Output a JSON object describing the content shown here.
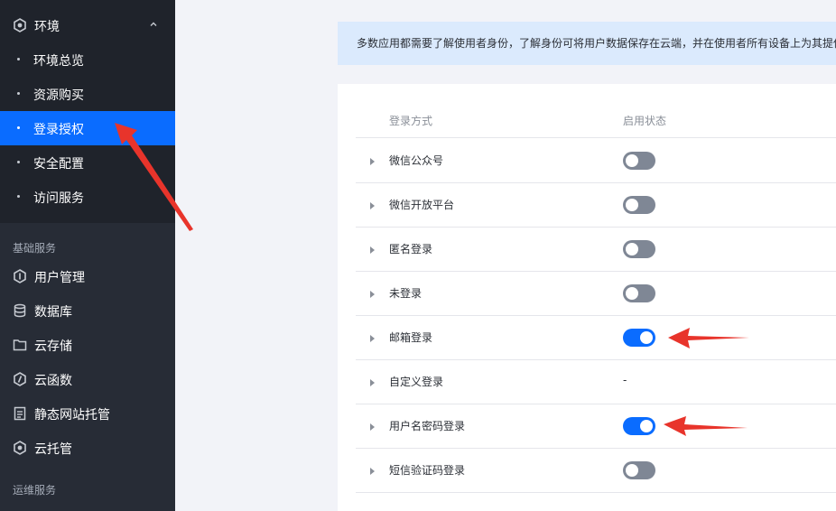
{
  "sidebar": {
    "env_group": {
      "label": "环境",
      "icon": "hexagon-icon",
      "expanded": true
    },
    "env_items": [
      {
        "label": "环境总览",
        "active": false
      },
      {
        "label": "资源购买",
        "active": false
      },
      {
        "label": "登录授权",
        "active": true
      },
      {
        "label": "安全配置",
        "active": false
      },
      {
        "label": "访问服务",
        "active": false
      }
    ],
    "sections": [
      {
        "title": "基础服务",
        "items": [
          {
            "label": "用户管理",
            "icon": "user-hexagon-icon"
          },
          {
            "label": "数据库",
            "icon": "database-icon"
          },
          {
            "label": "云存储",
            "icon": "folder-icon"
          },
          {
            "label": "云函数",
            "icon": "function-icon"
          },
          {
            "label": "静态网站托管",
            "icon": "document-icon"
          },
          {
            "label": "云托管",
            "icon": "hexagon-dot-icon"
          }
        ]
      },
      {
        "title": "运维服务",
        "items": []
      }
    ]
  },
  "main": {
    "banner_text": "多数应用都需要了解使用者身份，了解身份可将用户数据保存在云端，并在使用者所有设备上为其提供",
    "table": {
      "headers": {
        "method": "登录方式",
        "status": "启用状态"
      },
      "rows": [
        {
          "label": "微信公众号",
          "status": "off"
        },
        {
          "label": "微信开放平台",
          "status": "off"
        },
        {
          "label": "匿名登录",
          "status": "off"
        },
        {
          "label": "未登录",
          "status": "off"
        },
        {
          "label": "邮箱登录",
          "status": "on"
        },
        {
          "label": "自定义登录",
          "status": "-"
        },
        {
          "label": "用户名密码登录",
          "status": "on"
        },
        {
          "label": "短信验证码登录",
          "status": "off"
        }
      ]
    }
  },
  "colors": {
    "sidebar_bg": "#272c36",
    "sidebar_env_bg": "#1f232b",
    "active_bg": "#0a6cff",
    "toggle_on": "#0a6cff",
    "toggle_off": "#7f8795",
    "annotation_arrow": "#e8342b",
    "banner_bg": "#dbeafd"
  }
}
